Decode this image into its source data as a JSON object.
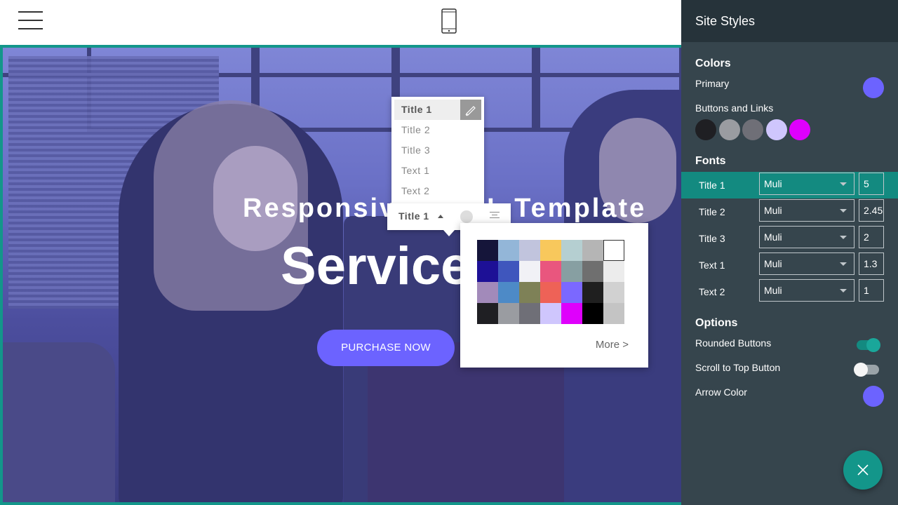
{
  "topbar": {
    "menu_icon": "hamburger-icon",
    "device_icon": "mobile-phone-icon"
  },
  "hero": {
    "subtitle": "Responsive HTML Template",
    "title": "Services",
    "button_label": "PURCHASE NOW",
    "accent_color": "#6c63ff"
  },
  "title_menu": {
    "items": [
      "Title 1",
      "Title 2",
      "Title 3",
      "Text 1",
      "Text 2"
    ],
    "selected": "Title 1",
    "edit_icon": "brush-icon"
  },
  "title_toolbar": {
    "label": "Title 1"
  },
  "color_picker": {
    "swatches": [
      "#15153a",
      "#93b6d8",
      "#c1c4dd",
      "#f8c85c",
      "#b5cfd1",
      "#b5b5b5",
      "#ffffff",
      "#1d1096",
      "#3f56bd",
      "#f1f1f6",
      "#e9567e",
      "#879fa2",
      "#6f6f6f",
      "#ececec",
      "#a28aba",
      "#4d8ac7",
      "#7e8157",
      "#ee6257",
      "#7b68ff",
      "#1f1f1f",
      "#d1d1d1",
      "#1f1f23",
      "#9a9ca1",
      "#6f6f77",
      "#cfc6fd",
      "#df00fc",
      "#000000",
      "#c4c4c4"
    ],
    "more_label": "More >"
  },
  "sidebar": {
    "title": "Site Styles",
    "colors": {
      "heading": "Colors",
      "primary_label": "Primary",
      "primary_color": "#6c63ff",
      "buttons_label": "Buttons and Links",
      "button_colors": [
        "#1f1f23",
        "#9a9ca1",
        "#6f6f77",
        "#cfc6fd",
        "#df00fc"
      ]
    },
    "fonts": {
      "heading": "Fonts",
      "rows": [
        {
          "name": "Title 1",
          "font": "Muli",
          "size": "5"
        },
        {
          "name": "Title 2",
          "font": "Muli",
          "size": "2.45"
        },
        {
          "name": "Title 3",
          "font": "Muli",
          "size": "2"
        },
        {
          "name": "Text 1",
          "font": "Muli",
          "size": "1.3"
        },
        {
          "name": "Text 2",
          "font": "Muli",
          "size": "1"
        }
      ]
    },
    "options": {
      "heading": "Options",
      "rounded_buttons_label": "Rounded Buttons",
      "rounded_buttons_on": true,
      "scroll_top_label": "Scroll to Top Button",
      "scroll_top_on": false,
      "arrow_color_label": "Arrow Color",
      "arrow_color": "#6c63ff"
    },
    "close_icon": "close-icon"
  }
}
